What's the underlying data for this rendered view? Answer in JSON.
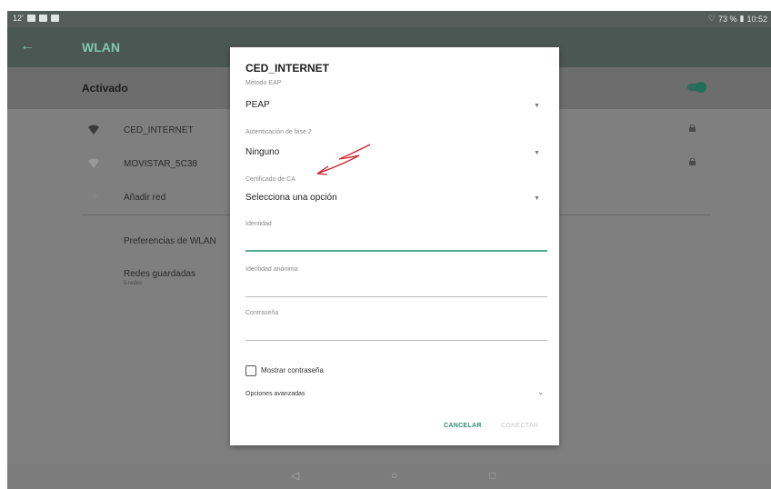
{
  "status_bar": {
    "time_left": "12'",
    "battery": "73 %",
    "time_right": "10:52"
  },
  "app_bar": {
    "back_icon": "arrow-left-icon",
    "title": "WLAN"
  },
  "wifi_toggle": {
    "label": "Activado",
    "on": true
  },
  "networks": [
    {
      "name": "CED_INTERNET",
      "icon": "wifi-full-icon",
      "locked": true
    },
    {
      "name": "MOVISTAR_5C38",
      "icon": "wifi-weak-icon",
      "locked": true
    },
    {
      "name": "Añadir red",
      "icon": "plus-icon",
      "locked": false
    }
  ],
  "preferences": {
    "wlan_prefs": "Preferencias de WLAN",
    "saved_networks": "Redes guardadas",
    "saved_networks_sub": "5 redes"
  },
  "dialog": {
    "title": "CED_INTERNET",
    "eap_method_label": "Método EAP",
    "eap_method_value": "PEAP",
    "phase2_label": "Autenticación de fase 2",
    "phase2_value": "Ninguno",
    "ca_cert_label": "Certificado de CA",
    "ca_cert_value": "Selecciona una opción",
    "identity_label": "Identidad",
    "anon_identity_label": "Identidad anónima",
    "password_label": "Contraseña",
    "show_password_label": "Mostrar contraseña",
    "advanced_label": "Opciones avanzadas",
    "cancel_label": "CANCELAR",
    "connect_label": "CONECTAR"
  },
  "nav_bar": {
    "back": "◁",
    "home": "○",
    "recents": "□"
  },
  "colors": {
    "accent": "#2f8c74",
    "annotation": "#d0202a"
  }
}
